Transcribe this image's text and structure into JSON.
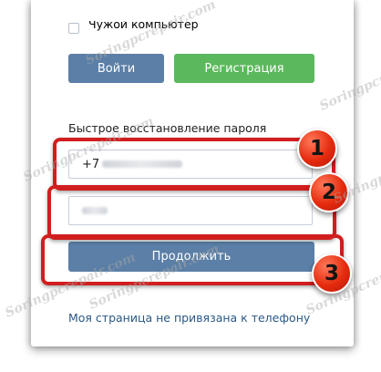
{
  "form": {
    "checkbox_label": "Чужой компьютер",
    "login_button": "Войти",
    "register_button": "Регистрация",
    "recovery_title": "Быстрое восстановление пароля",
    "phone_prefix": "+7",
    "continue_button": "Продолжить",
    "no_phone_link": "Моя страница не привязана к телефону"
  },
  "annotations": {
    "step1": "1",
    "step2": "2",
    "step3": "3"
  },
  "watermark": {
    "text": "Soringpcrepair.com"
  },
  "colors": {
    "primary_button": "#5b7fa6",
    "register_button": "#5cb85c",
    "highlight": "#d11e1e",
    "badge": "#e52b0e",
    "link": "#2a5885"
  }
}
